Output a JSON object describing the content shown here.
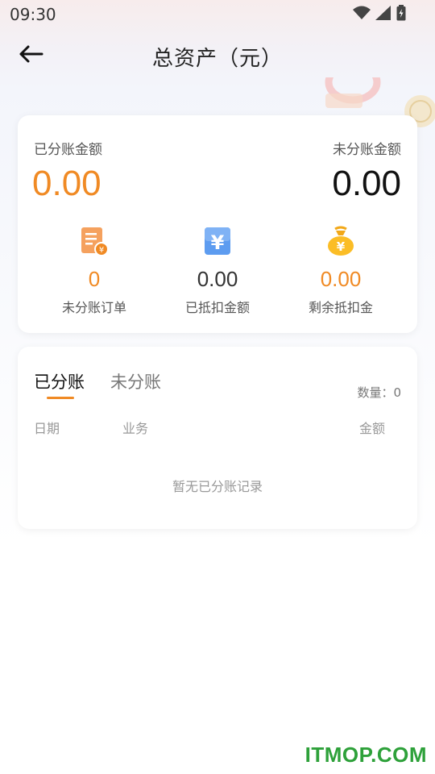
{
  "status_bar": {
    "time": "09:30",
    "icons": [
      "wifi-icon",
      "cell-signal-icon",
      "battery-icon"
    ]
  },
  "header": {
    "title": "总资产（元）",
    "back_icon": "arrow-left-icon"
  },
  "summary": {
    "settled_label": "已分账金额",
    "settled_value": "0.00",
    "unsettled_label": "未分账金额",
    "unsettled_value": "0.00",
    "stats": [
      {
        "icon": "order-receipt-icon",
        "value": "0",
        "label": "未分账订单"
      },
      {
        "icon": "yuan-card-icon",
        "value": "0.00",
        "label": "已抵扣金额"
      },
      {
        "icon": "money-bag-icon",
        "value": "0.00",
        "label": "剩余抵扣金"
      }
    ]
  },
  "records": {
    "tabs": [
      {
        "label": "已分账",
        "active": true
      },
      {
        "label": "未分账",
        "active": false
      }
    ],
    "count_label": "数量：",
    "count_value": "0",
    "columns": [
      "日期",
      "业务",
      "金额"
    ],
    "empty_text": "暂无已分账记录"
  },
  "watermark": "ITMOP.COM",
  "colors": {
    "accent": "#f08a24",
    "watermark": "#2ea13a",
    "card_bg": "#ffffff"
  }
}
